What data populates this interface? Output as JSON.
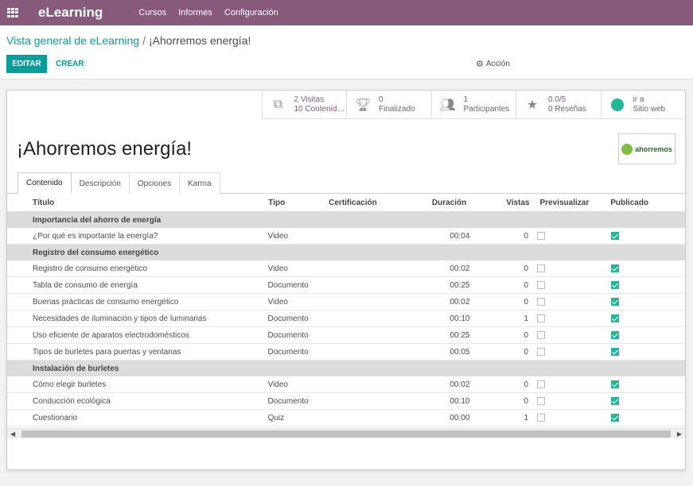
{
  "navbar": {
    "brand": "eLearning",
    "menu": [
      "Cursos",
      "Informes",
      "Configuración"
    ]
  },
  "breadcrumb": {
    "parent": "Vista general de eLearning",
    "separator": "/",
    "current": "¡Ahorremos energía!"
  },
  "toolbar": {
    "edit_label": "EDITAR",
    "create_label": "CREAR",
    "action_label": "Acción"
  },
  "stats": [
    {
      "icon": "copy-icon",
      "value": "2 Visitas",
      "label": "10 Contenid…"
    },
    {
      "icon": "trophy-icon",
      "value": "0",
      "label": "Finalizado"
    },
    {
      "icon": "users-icon",
      "value": "1",
      "label": "Participantes"
    },
    {
      "icon": "star-icon",
      "value": "0.0/5",
      "label": "0 Reseñas"
    },
    {
      "icon": "globe-icon",
      "value": "ir a",
      "label": "Sitio web"
    }
  ],
  "record": {
    "title": "¡Ahorremos energía!",
    "logo_text": "ahorremos"
  },
  "tabs": [
    "Contenido",
    "Descripción",
    "Opciones",
    "Karma"
  ],
  "columns": {
    "title": "Título",
    "type": "Tipo",
    "cert": "Certificación",
    "duration": "Duración",
    "views": "Vistas",
    "preview": "Previsualizar",
    "published": "Publicado"
  },
  "groups": [
    {
      "name": "Importancia del ahorro de energía",
      "rows": [
        {
          "title": "¿Por qué es importante la energía?",
          "type": "Video",
          "duration": "00:04",
          "views": "0",
          "preview": false,
          "published": true
        }
      ]
    },
    {
      "name": "Registro del consumo energético",
      "rows": [
        {
          "title": "Registro de consumo energético",
          "type": "Video",
          "duration": "00:02",
          "views": "0",
          "preview": false,
          "published": true
        },
        {
          "title": "Tabla de consumo de energía",
          "type": "Documento",
          "duration": "00:25",
          "views": "0",
          "preview": false,
          "published": true
        },
        {
          "title": "Buenas prácticas de consumo energético",
          "type": "Video",
          "duration": "00:02",
          "views": "0",
          "preview": false,
          "published": true
        },
        {
          "title": "Necesidades de iluminación y tipos de luminarias",
          "type": "Documento",
          "duration": "00:10",
          "views": "1",
          "preview": false,
          "published": true
        },
        {
          "title": "Uso eficiente de aparatos electrodomésticos",
          "type": "Documento",
          "duration": "00:25",
          "views": "0",
          "preview": false,
          "published": true
        },
        {
          "title": "Tipos de burletes para puertas y ventanas",
          "type": "Documento",
          "duration": "00:05",
          "views": "0",
          "preview": false,
          "published": true
        }
      ]
    },
    {
      "name": "Instalación de burletes",
      "rows": [
        {
          "title": "Cómo elegir burletes",
          "type": "Video",
          "duration": "00:02",
          "views": "0",
          "preview": false,
          "published": true
        },
        {
          "title": "Conducción ecológica",
          "type": "Documento",
          "duration": "00:10",
          "views": "0",
          "preview": false,
          "published": true
        },
        {
          "title": "Cuestionario",
          "type": "Quiz",
          "duration": "00:00",
          "views": "1",
          "preview": false,
          "published": true
        }
      ]
    }
  ],
  "colors": {
    "brand": "#875a7b",
    "accent": "#00a09d",
    "check": "#21b799"
  }
}
